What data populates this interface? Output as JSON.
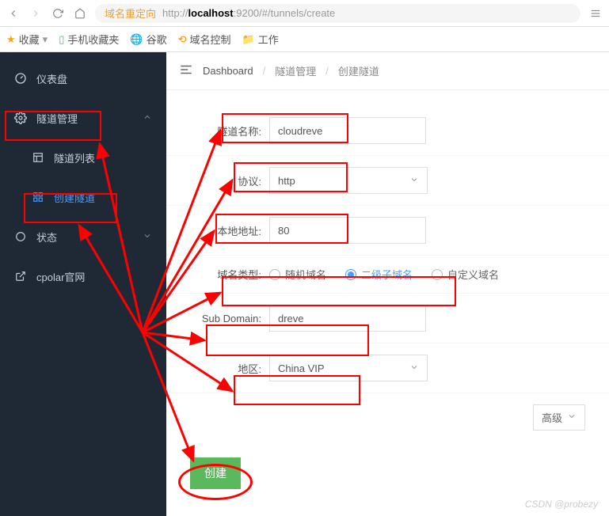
{
  "browser": {
    "redirect_label": "域名重定向",
    "url_prefix": "http://",
    "url_host": "localhost",
    "url_rest": ":9200/#/tunnels/create"
  },
  "bookmarks": {
    "fav": "收藏",
    "mobile": "手机收藏夹",
    "google": "谷歌",
    "domain": "域名控制",
    "work": "工作"
  },
  "sidebar": {
    "dashboard": "仪表盘",
    "tunnels": "隧道管理",
    "tunnel_list": "隧道列表",
    "create_tunnel": "创建隧道",
    "status": "状态",
    "official": "cpolar官网"
  },
  "breadcrumb": {
    "a": "Dashboard",
    "b": "隧道管理",
    "c": "创建隧道"
  },
  "form": {
    "name_label": "隧道名称:",
    "name_value": "cloudreve",
    "proto_label": "协议:",
    "proto_value": "http",
    "local_label": "本地地址:",
    "local_value": "80",
    "domain_type_label": "域名类型:",
    "domain_random": "随机域名",
    "domain_sub": "二级子域名",
    "domain_custom": "自定义域名",
    "subdomain_label": "Sub Domain:",
    "subdomain_value": "dreve",
    "region_label": "地区:",
    "region_value": "China VIP",
    "advanced": "高级",
    "submit": "创建"
  },
  "watermark": "CSDN @probezy"
}
